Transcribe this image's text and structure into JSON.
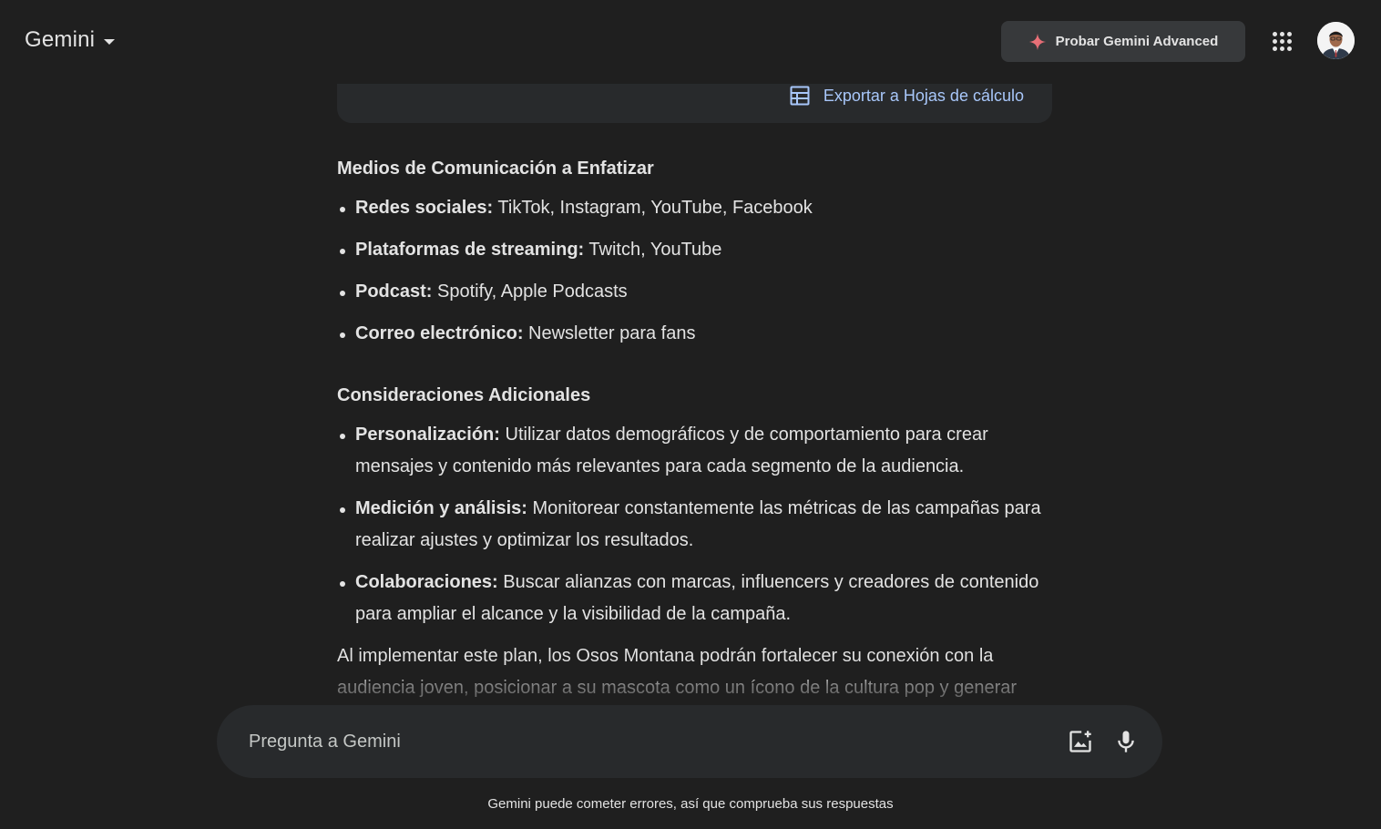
{
  "header": {
    "brand": "Gemini",
    "advanced_button": "Probar Gemini Advanced"
  },
  "table_card": {
    "export_label": "Exportar a Hojas de cálculo"
  },
  "sections": [
    {
      "heading": "Medios de Comunicación a Enfatizar",
      "items": [
        {
          "term": "Redes sociales:",
          "text": " TikTok, Instagram, YouTube, Facebook"
        },
        {
          "term": "Plataformas de streaming:",
          "text": " Twitch, YouTube"
        },
        {
          "term": "Podcast:",
          "text": " Spotify, Apple Podcasts"
        },
        {
          "term": "Correo electrónico:",
          "text": " Newsletter para fans"
        }
      ]
    },
    {
      "heading": "Consideraciones Adicionales",
      "items": [
        {
          "term": "Personalización:",
          "text": " Utilizar datos demográficos y de comportamiento para crear mensajes y contenido más relevantes para cada segmento de la audiencia."
        },
        {
          "term": "Medición y análisis:",
          "text": " Monitorear constantemente las métricas de las campañas para realizar ajustes y optimizar los resultados."
        },
        {
          "term": "Colaboraciones:",
          "text": " Buscar alianzas con marcas, influencers y creadores de contenido para ampliar el alcance y la visibilidad de la campaña."
        }
      ]
    }
  ],
  "closing_paragraph": "Al implementar este plan, los Osos Montana podrán fortalecer su conexión con la audiencia joven, posicionar a su mascota como un ícono de la cultura pop y generar",
  "input": {
    "placeholder": "Pregunta a Gemini"
  },
  "disclaimer": "Gemini puede cometer errores, así que comprueba sus respuestas",
  "colors": {
    "background": "#1f1f1f",
    "surface": "#282a2c",
    "text": "#e3e3e3",
    "link": "#a8c7fa",
    "spark_accent": "#f5797d"
  }
}
